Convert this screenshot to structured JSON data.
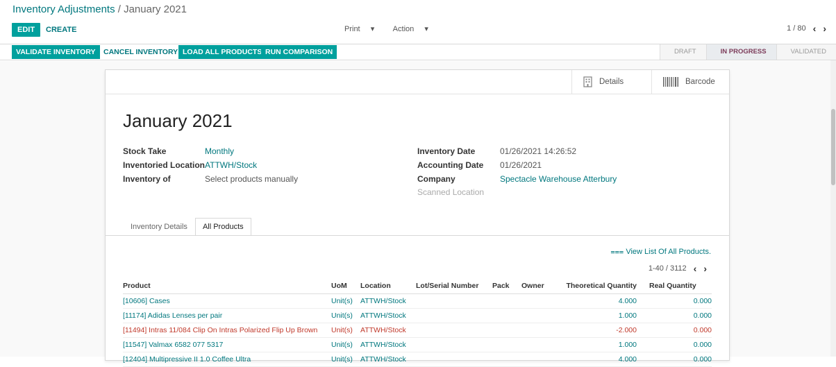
{
  "breadcrumb": {
    "parent": "Inventory Adjustments",
    "separator": "/",
    "current": "January 2021"
  },
  "toolbar": {
    "edit_label": "EDIT",
    "create_label": "CREATE",
    "print_label": "Print",
    "action_label": "Action",
    "pager": "1 / 80"
  },
  "statusbar": {
    "validate_label": "VALIDATE INVENTORY",
    "cancel_label": "CANCEL INVENTORY",
    "load_label": "LOAD ALL PRODUCTS",
    "run_label": "RUN COMPARISON",
    "stages": [
      "DRAFT",
      "IN PROGRESS",
      "VALIDATED"
    ],
    "active_stage": "IN PROGRESS"
  },
  "smart_buttons": {
    "details_label": "Details",
    "barcode_label": "Barcode"
  },
  "form": {
    "title": "January 2021",
    "left": [
      {
        "label": "Stock Take",
        "value": "Monthly"
      },
      {
        "label": "Inventoried Location",
        "value": "ATTWH/Stock"
      },
      {
        "label": "Inventory of",
        "value": "Select products manually"
      }
    ],
    "right": [
      {
        "label": "Inventory Date",
        "value": "01/26/2021 14:26:52"
      },
      {
        "label": "Accounting Date",
        "value": "01/26/2021"
      },
      {
        "label": "Company",
        "value": "Spectacle Warehouse Atterbury"
      },
      {
        "label": "Scanned Location",
        "value": ""
      }
    ]
  },
  "tabs": [
    "Inventory Details",
    "All Products"
  ],
  "active_tab": "All Products",
  "lines": {
    "view_list_label": "View List Of All Products.",
    "pager": "1-40 / 3112",
    "columns": [
      "Product",
      "UoM",
      "Location",
      "Lot/Serial Number",
      "Pack",
      "Owner",
      "Theoretical Quantity",
      "Real Quantity"
    ],
    "rows": [
      {
        "product": "[10606] Cases",
        "uom": "Unit(s)",
        "location": "ATTWH/Stock",
        "lot": "",
        "pack": "",
        "owner": "",
        "theoretical": "4.000",
        "real": "0.000"
      },
      {
        "product": "[11174] Adidas Lenses per pair",
        "uom": "Unit(s)",
        "location": "ATTWH/Stock",
        "lot": "",
        "pack": "",
        "owner": "",
        "theoretical": "1.000",
        "real": "0.000"
      },
      {
        "product": "[11494] Intras 11/084 Clip On Intras Polarized Flip Up Brown",
        "uom": "Unit(s)",
        "location": "ATTWH/Stock",
        "lot": "",
        "pack": "",
        "owner": "",
        "theoretical": "-2.000",
        "real": "0.000"
      },
      {
        "product": "[11547] Valmax 6582 077 5317",
        "uom": "Unit(s)",
        "location": "ATTWH/Stock",
        "lot": "",
        "pack": "",
        "owner": "",
        "theoretical": "1.000",
        "real": "0.000"
      },
      {
        "product": "[12404] Multipressive II 1.0 Coffee Ultra",
        "uom": "Unit(s)",
        "location": "ATTWH/Stock",
        "lot": "",
        "pack": "",
        "owner": "",
        "theoretical": "4.000",
        "real": "0.000"
      }
    ]
  }
}
